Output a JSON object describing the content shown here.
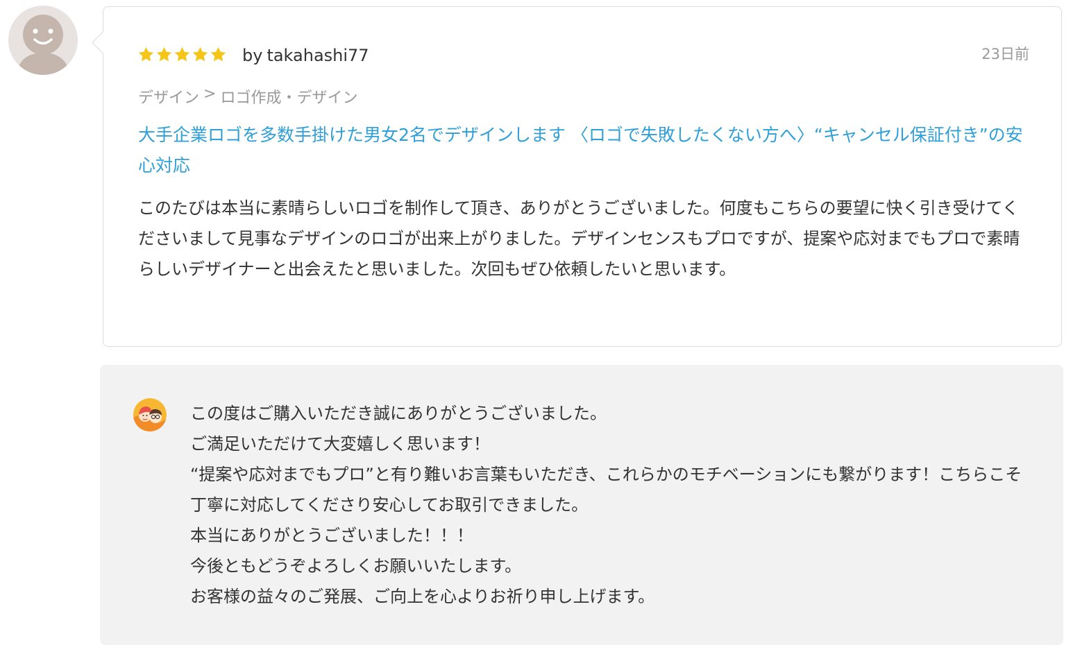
{
  "review": {
    "rating": 5,
    "rating_max": 5,
    "star_color": "#f5c518",
    "by_label": "by",
    "username": "takahashi77",
    "date": "23日前",
    "breadcrumb": {
      "category": "デザイン",
      "separator": ">",
      "subcategory": "ロゴ作成・デザイン"
    },
    "service_title": "大手企業ロゴを多数手掛けた男女2名でデザインします 〈ロゴで失敗したくない方へ〉“キャンセル保証付き”の安心対応",
    "body": "このたびは本当に素晴らしいロゴを制作して頂き、ありがとうございました。何度もこちらの要望に快く引き受けてくださいまして見事なデザインのロゴが出来上がりました。デザインセンスもプロですが、提案や応対までもプロで素晴らしいデザイナーと出会えたと思いました。次回もぜひ依頼したいと思います。"
  },
  "reply": {
    "lines": [
      "この度はご購入いただき誠にありがとうございました。",
      "ご満足いただけて大変嬉しく思います！",
      "“提案や応対までもプロ”と有り難いお言葉もいただき、これらかのモチベーションにも繋がります！こちらこそ丁寧に対応してくださり安心してお取引できました。",
      "本当にありがとうございました！！！",
      "今後ともどうぞよろしくお願いいたします。",
      "お客様の益々のご発展、ご向上を心よりお祈り申し上げます。"
    ]
  },
  "colors": {
    "link": "#2f9fd9",
    "muted_text": "#999999",
    "body_text": "#333333",
    "reply_background": "#f2f2f2",
    "card_border": "#dcdcdc"
  },
  "icons": {
    "reviewer_avatar": "default-user-avatar-icon",
    "seller_avatar": "seller-avatar-icon",
    "star": "star-icon"
  }
}
